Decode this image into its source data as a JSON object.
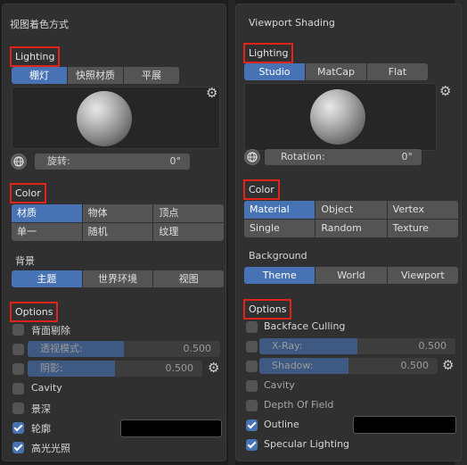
{
  "left": {
    "title": "视图着色方式",
    "lighting": {
      "header": "Lighting",
      "modes": [
        {
          "label": "棚灯",
          "active": true
        },
        {
          "label": "快照材质",
          "active": false
        },
        {
          "label": "平展",
          "active": false
        }
      ],
      "rotation_label": "旋转:",
      "rotation_value": "0°"
    },
    "color": {
      "header": "Color",
      "options": [
        {
          "label": "材质",
          "active": true
        },
        {
          "label": "物体",
          "active": false
        },
        {
          "label": "顶点",
          "active": false
        },
        {
          "label": "单一",
          "active": false
        },
        {
          "label": "随机",
          "active": false
        },
        {
          "label": "纹理",
          "active": false
        }
      ]
    },
    "background": {
      "header": "背景",
      "options": [
        {
          "label": "主题",
          "active": true
        },
        {
          "label": "世界环境",
          "active": false
        },
        {
          "label": "视图",
          "active": false
        }
      ]
    },
    "options": {
      "header": "Options",
      "backface": {
        "label": "背面剔除",
        "checked": false
      },
      "xray": {
        "label": "透视模式:",
        "value": "0.500",
        "fill": 0.5
      },
      "shadow": {
        "label": "阴影:",
        "value": "0.500",
        "fill": 0.5
      },
      "cavity": {
        "label": "Cavity",
        "checked": false
      },
      "dof": {
        "label": "景深",
        "checked": false
      },
      "outline": {
        "label": "轮廓",
        "checked": true
      },
      "specular": {
        "label": "高光光照",
        "checked": true
      }
    }
  },
  "right": {
    "title": "Viewport Shading",
    "lighting": {
      "header": "Lighting",
      "modes": [
        {
          "label": "Studio",
          "active": true
        },
        {
          "label": "MatCap",
          "active": false
        },
        {
          "label": "Flat",
          "active": false
        }
      ],
      "rotation_label": "Rotation:",
      "rotation_value": "0°"
    },
    "color": {
      "header": "Color",
      "options": [
        {
          "label": "Material",
          "active": true
        },
        {
          "label": "Object",
          "active": false
        },
        {
          "label": "Vertex",
          "active": false
        },
        {
          "label": "Single",
          "active": false
        },
        {
          "label": "Random",
          "active": false
        },
        {
          "label": "Texture",
          "active": false
        }
      ]
    },
    "background": {
      "header": "Background",
      "options": [
        {
          "label": "Theme",
          "active": true
        },
        {
          "label": "World",
          "active": false
        },
        {
          "label": "Viewport",
          "active": false
        }
      ]
    },
    "options": {
      "header": "Options",
      "backface": {
        "label": "Backface Culling",
        "checked": false
      },
      "xray": {
        "label": "X-Ray:",
        "value": "0.500",
        "fill": 0.5
      },
      "shadow": {
        "label": "Shadow:",
        "value": "0.500",
        "fill": 0.5
      },
      "cavity": {
        "label": "Cavity",
        "checked": false
      },
      "dof": {
        "label": "Depth Of Field",
        "checked": false
      },
      "outline": {
        "label": "Outline",
        "checked": true
      },
      "specular": {
        "label": "Specular Lighting",
        "checked": true
      }
    }
  },
  "colors": {
    "accent": "#4772b3",
    "highlight_box": "#e2231a",
    "outline_color": "#000000"
  }
}
